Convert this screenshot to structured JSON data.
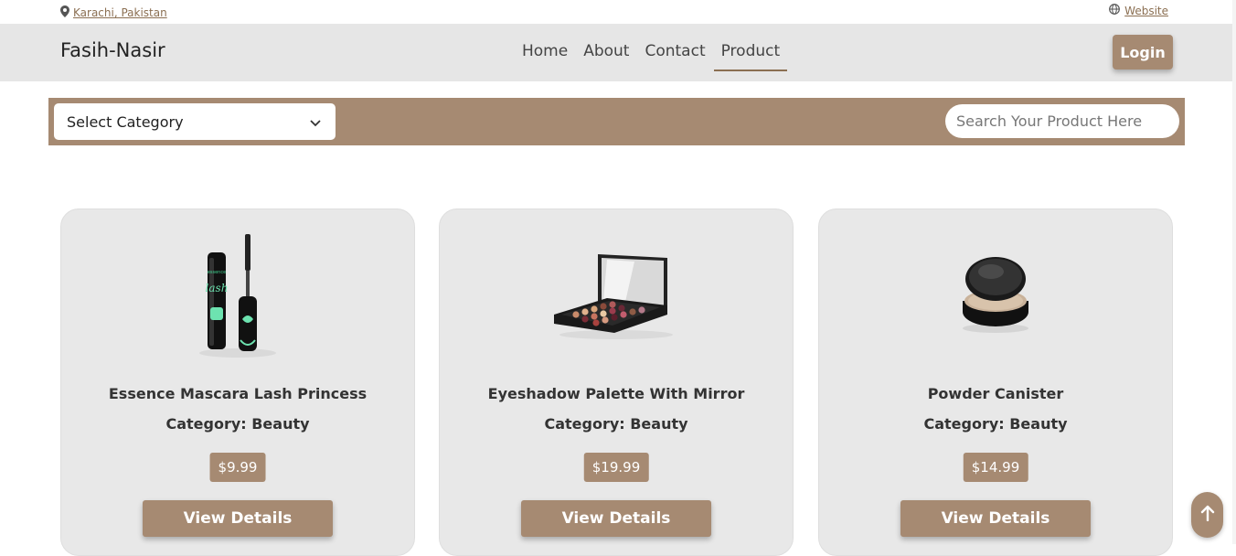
{
  "topbar": {
    "location": "Karachi, Pakistan",
    "website": "Website"
  },
  "navbar": {
    "brand": "Fasih-Nasir",
    "links": [
      "Home",
      "About",
      "Contact",
      "Product"
    ],
    "active": "Product",
    "login_label": "Login"
  },
  "filters": {
    "category_selected": "Select Category",
    "search_placeholder": "Search Your Product Here"
  },
  "products": [
    {
      "title": "Essence Mascara Lash Princess",
      "category": "Category: Beauty",
      "price": "$9.99",
      "button": "View Details"
    },
    {
      "title": "Eyeshadow Palette With Mirror",
      "category": "Category: Beauty",
      "price": "$19.99",
      "button": "View Details"
    },
    {
      "title": "Powder Canister",
      "category": "Category: Beauty",
      "price": "$14.99",
      "button": "View Details"
    }
  ],
  "colors": {
    "accent": "#a68a72",
    "navbar_bg": "#e6e6e6",
    "card_bg": "#e8e8e8"
  }
}
